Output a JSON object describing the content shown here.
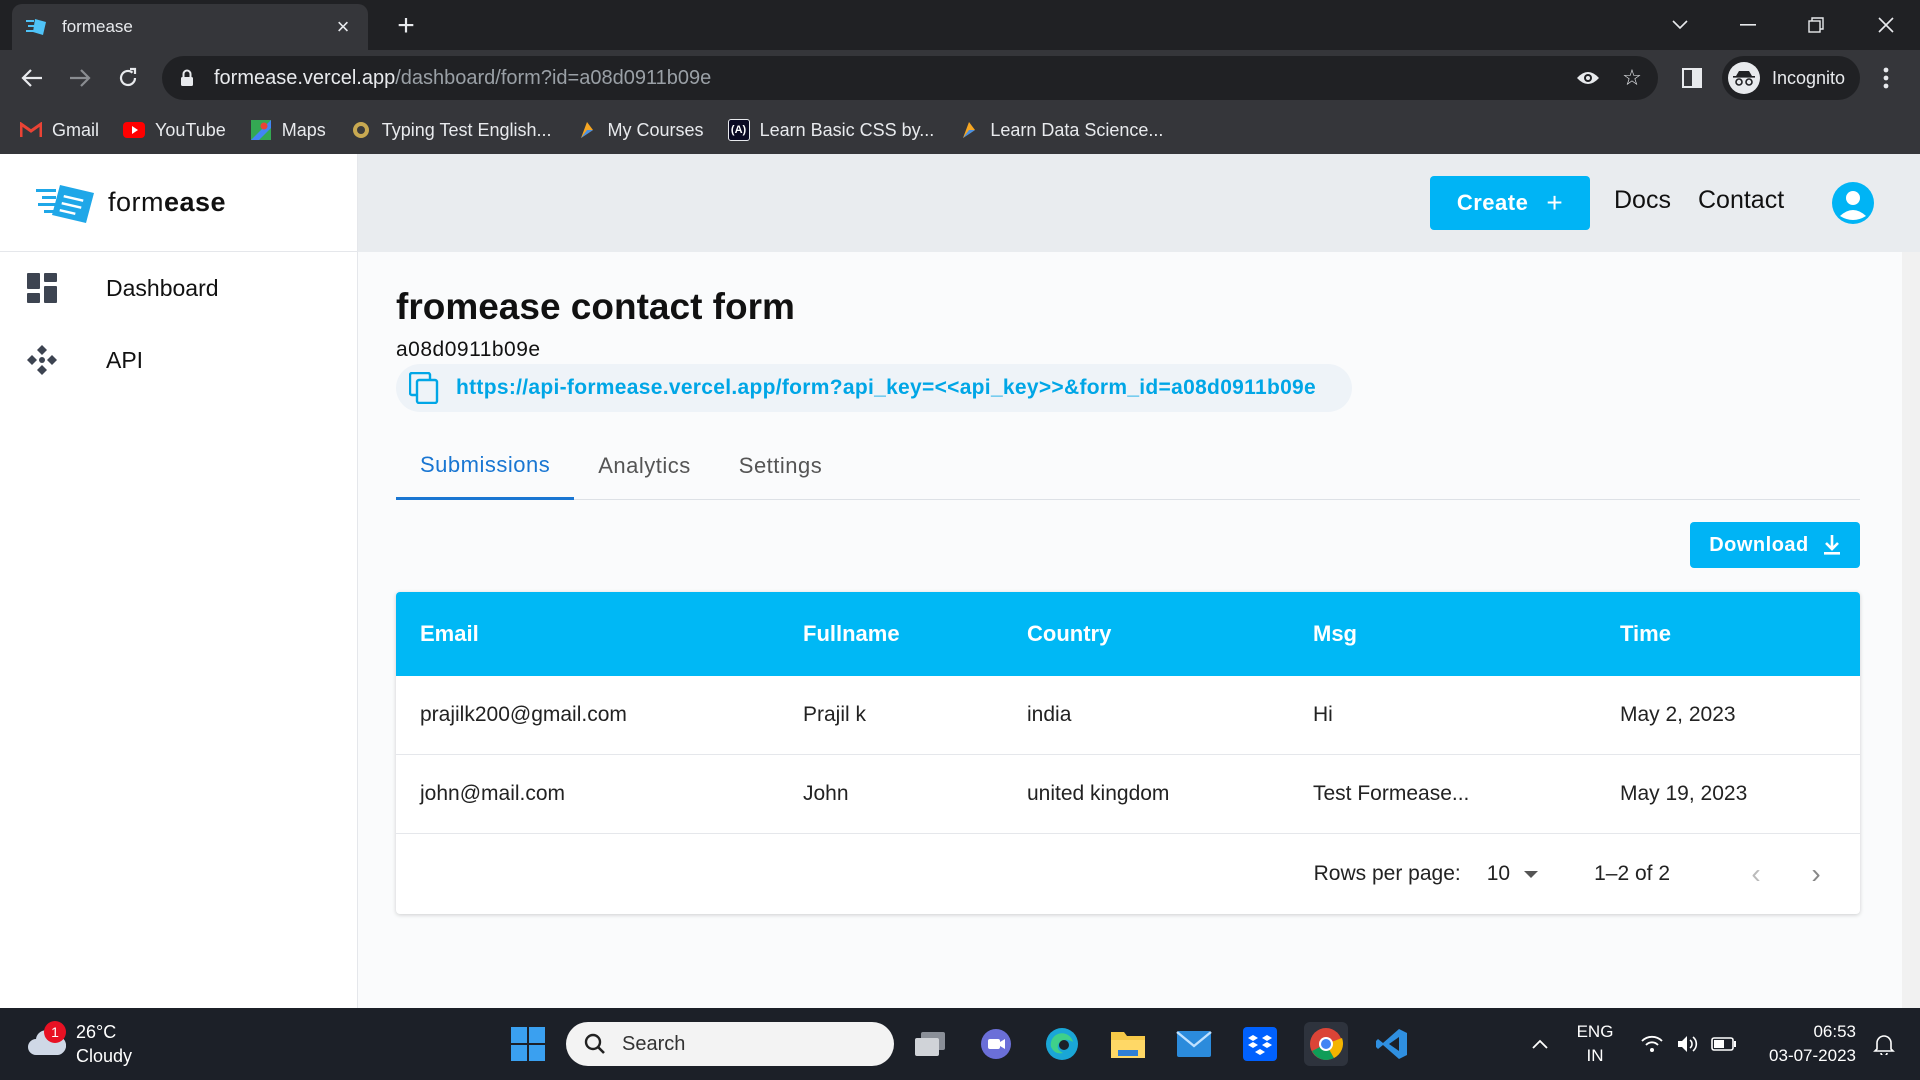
{
  "browser": {
    "tab_title": "formease",
    "url_host": "formease.vercel.app",
    "url_path": "/dashboard/form?id=a08d0911b09e",
    "profile_label": "Incognito",
    "bookmarks": [
      {
        "label": "Gmail",
        "icon": "gmail-icon"
      },
      {
        "label": "YouTube",
        "icon": "youtube-icon"
      },
      {
        "label": "Maps",
        "icon": "maps-icon"
      },
      {
        "label": "Typing Test English...",
        "icon": "typing-test-icon"
      },
      {
        "label": "My Courses",
        "icon": "courses-icon"
      },
      {
        "label": "Learn Basic CSS by...",
        "icon": "freecodecamp-icon"
      },
      {
        "label": "Learn Data Science...",
        "icon": "data-science-icon"
      }
    ]
  },
  "app": {
    "brand_light": "form",
    "brand_bold": "ease",
    "sidebar": [
      {
        "label": "Dashboard",
        "icon": "dashboard-icon"
      },
      {
        "label": "API",
        "icon": "api-icon"
      }
    ],
    "topbar": {
      "create_label": "Create",
      "docs_label": "Docs",
      "contact_label": "Contact"
    },
    "form": {
      "title": "fromease contact form",
      "id": "a08d0911b09e",
      "api_url": "https://api-formease.vercel.app/form?api_key=<<api_key>>&form_id=a08d0911b09e"
    },
    "tabs": [
      "Submissions",
      "Analytics",
      "Settings"
    ],
    "download_label": "Download",
    "table": {
      "columns": [
        "Email",
        "Fullname",
        "Country",
        "Msg",
        "Time"
      ],
      "rows": [
        [
          "prajilk200@gmail.com",
          "Prajil k",
          "india",
          "Hi",
          "May 2, 2023"
        ],
        [
          "john@mail.com",
          "John",
          "united kingdom",
          "Test Formease...",
          "May 19, 2023"
        ]
      ]
    },
    "pagination": {
      "rows_per_page_label": "Rows per page:",
      "rows_per_page": "10",
      "range": "1–2 of 2"
    },
    "colors": {
      "accent": "#00b4f5",
      "tab_active": "#1976d2"
    }
  },
  "taskbar": {
    "weather_temp": "26°C",
    "weather_desc": "Cloudy",
    "weather_badge": "1",
    "search_placeholder": "Search",
    "lang_top": "ENG",
    "lang_bottom": "IN",
    "time": "06:53",
    "date": "03-07-2023"
  }
}
